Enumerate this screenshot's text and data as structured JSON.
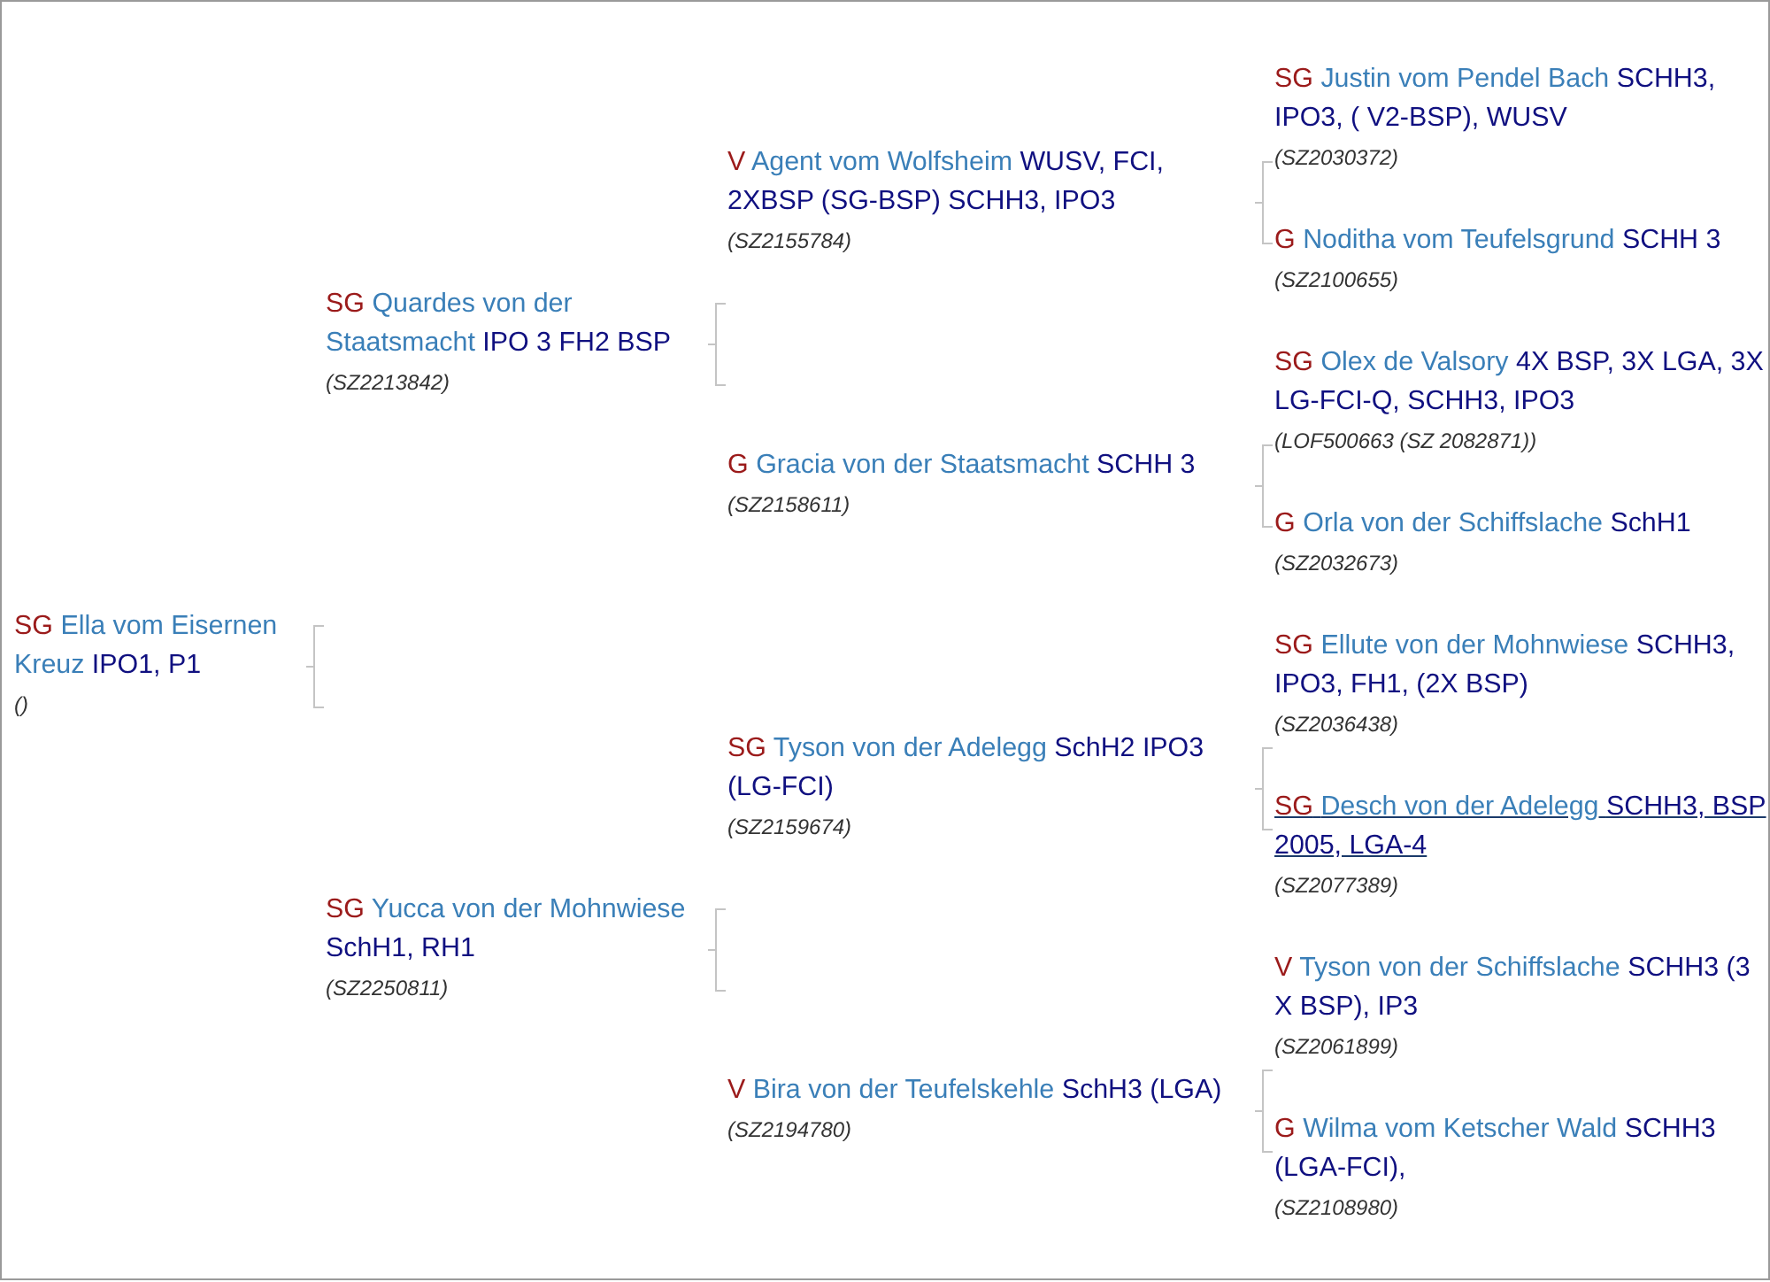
{
  "pedigree": {
    "rating": "SG",
    "name": "Ella vom Eisernen Kreuz",
    "titles": "IPO1, P1",
    "registration": "()",
    "hovered": false,
    "children": [
      {
        "rating": "SG",
        "name": "Quardes von der Staatsmacht",
        "titles": "IPO 3 FH2 BSP",
        "registration": "(SZ2213842)",
        "hovered": false,
        "children": [
          {
            "rating": "V",
            "name": "Agent vom Wolfsheim",
            "titles": "WUSV, FCI, 2XBSP (SG-BSP) SCHH3, IPO3",
            "registration": "(SZ2155784)",
            "hovered": false,
            "children": [
              {
                "rating": "SG",
                "name": "Justin vom Pendel Bach",
                "titles": "SCHH3, IPO3, ( V2-BSP), WUSV",
                "registration": "(SZ2030372)",
                "hovered": false
              },
              {
                "rating": "G",
                "name": "Noditha vom Teufelsgrund",
                "titles": "SCHH 3",
                "registration": "(SZ2100655)",
                "hovered": false
              }
            ]
          },
          {
            "rating": "G",
            "name": "Gracia von der Staatsmacht",
            "titles": "SCHH 3",
            "registration": "(SZ2158611)",
            "hovered": false,
            "children": [
              {
                "rating": "SG",
                "name": "Olex de Valsory",
                "titles": "4X BSP, 3X LGA, 3X LG-FCI-Q, SCHH3, IPO3",
                "registration": "(LOF500663 (SZ 2082871))",
                "hovered": false
              },
              {
                "rating": "G",
                "name": "Orla von der Schiffslache",
                "titles": "SchH1",
                "registration": "(SZ2032673)",
                "hovered": false
              }
            ]
          }
        ]
      },
      {
        "rating": "SG",
        "name": "Yucca von der Mohnwiese",
        "titles": "SchH1, RH1",
        "registration": "(SZ2250811)",
        "hovered": false,
        "children": [
          {
            "rating": "SG",
            "name": "Tyson von der Adelegg",
            "titles": "SchH2 IPO3 (LG-FCI)",
            "registration": "(SZ2159674)",
            "hovered": false,
            "children": [
              {
                "rating": "SG",
                "name": "Ellute von der Mohnwiese",
                "titles": "SCHH3, IPO3, FH1, (2X BSP)",
                "registration": "(SZ2036438)",
                "hovered": false
              },
              {
                "rating": "SG",
                "name": "Desch von der Adelegg",
                "titles": "SCHH3, BSP 2005, LGA-4",
                "registration": "(SZ2077389)",
                "hovered": true
              }
            ]
          },
          {
            "rating": "V",
            "name": "Bira von der Teufelskehle",
            "titles": "SchH3 (LGA)",
            "registration": "(SZ2194780)",
            "hovered": false,
            "children": [
              {
                "rating": "V",
                "name": "Tyson von der Schiffslache",
                "titles": "SCHH3 (3 X BSP), IP3",
                "registration": "(SZ2061899)",
                "hovered": false
              },
              {
                "rating": "G",
                "name": "Wilma vom Ketscher Wald",
                "titles": "SCHH3 (LGA-FCI),",
                "registration": "(SZ2108980)",
                "hovered": false
              }
            ]
          }
        ]
      }
    ]
  }
}
